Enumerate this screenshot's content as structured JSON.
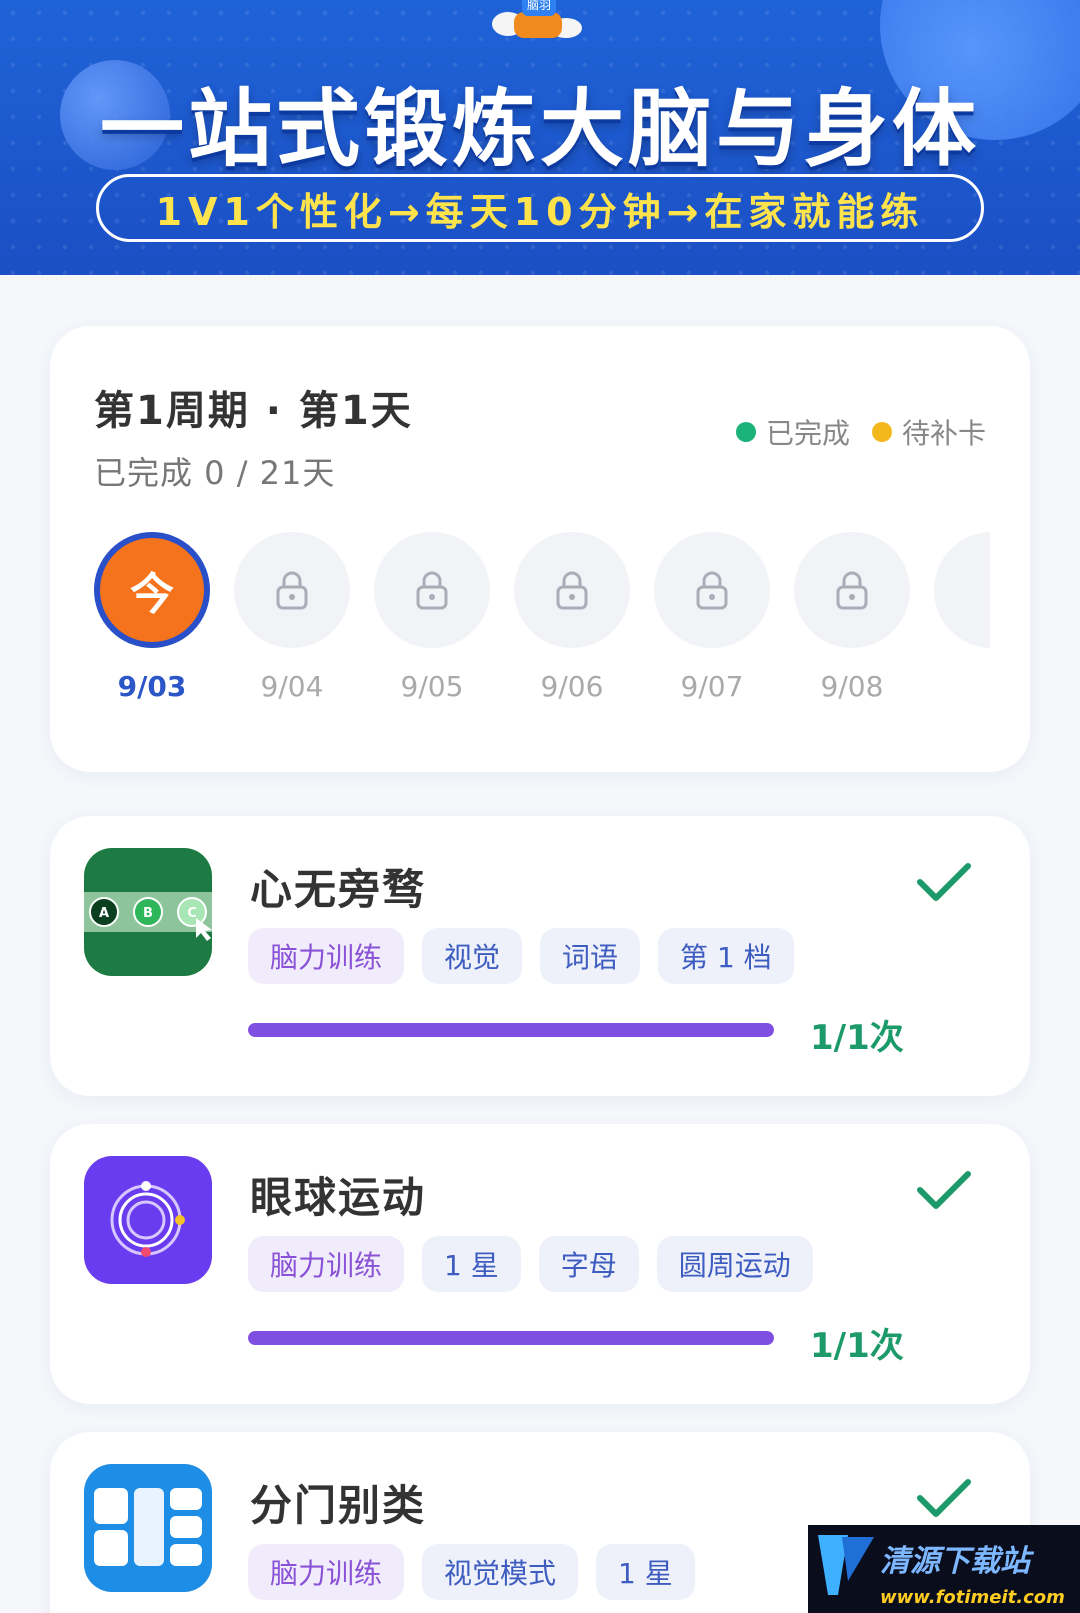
{
  "banner": {
    "mascot_text": "脑羽",
    "title": "一站式锻炼大脑与身体",
    "subtitle": "1V1个性化→每天10分钟→在家就能练"
  },
  "progress": {
    "cycle_title": "第1周期 · 第1天",
    "completed_text": "已完成 0 / 21天",
    "legend": [
      {
        "label": "已完成",
        "color": "#1bb27a"
      },
      {
        "label": "待补卡",
        "color": "#f5b81c"
      }
    ],
    "today_glyph": "今",
    "days": [
      {
        "date": "9/03",
        "state": "today"
      },
      {
        "date": "9/04",
        "state": "locked",
        "icon": "lock-icon"
      },
      {
        "date": "9/05",
        "state": "locked",
        "icon": "lock-icon"
      },
      {
        "date": "9/06",
        "state": "locked",
        "icon": "lock-icon"
      },
      {
        "date": "9/07",
        "state": "locked",
        "icon": "lock-icon"
      },
      {
        "date": "9/08",
        "state": "locked",
        "icon": "lock-icon"
      }
    ]
  },
  "exercises": [
    {
      "title": "心无旁骛",
      "tags": [
        "脑力训练",
        "视觉",
        "词语",
        "第 1 档"
      ],
      "progress": 1,
      "count_text": "1/1次",
      "completed": true,
      "icon": "abc-focus-icon",
      "icon_letters": [
        "A",
        "B",
        "C"
      ]
    },
    {
      "title": "眼球运动",
      "tags": [
        "脑力训练",
        "1 星",
        "字母",
        "圆周运动"
      ],
      "progress": 1,
      "count_text": "1/1次",
      "completed": true,
      "icon": "orbit-icon"
    },
    {
      "title": "分门别类",
      "tags": [
        "脑力训练",
        "视觉模式",
        "1 星"
      ],
      "completed": true,
      "icon": "grid-sort-icon"
    }
  ],
  "watermark": {
    "name": "清源下载站",
    "url": "www.fotimeit.com"
  },
  "colors": {
    "banner_blue": "#1f63d8",
    "today_orange": "#f5731c",
    "today_ring": "#2950c8",
    "progress_purple": "#7e4fe0",
    "check_green": "#1c9a6a"
  }
}
